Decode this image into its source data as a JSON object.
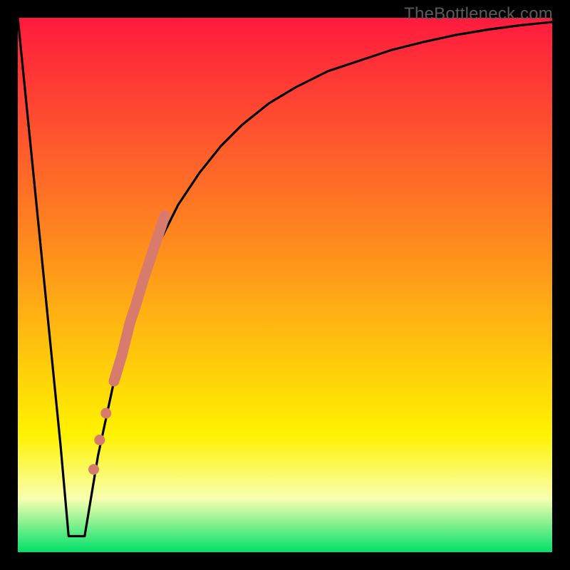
{
  "watermark": "TheBottleneck.com",
  "colors": {
    "frame": "#000000",
    "curve": "#000000",
    "markers": "#d97b6c",
    "gradient_top": "#ff1a3e",
    "gradient_mid1": "#ff8a1e",
    "gradient_mid2": "#fff200",
    "gradient_band": "#f8ffb0",
    "gradient_bottom": "#00e06a"
  },
  "chart_data": {
    "type": "line",
    "title": "",
    "xlabel": "",
    "ylabel": "",
    "xlim": [
      0,
      100
    ],
    "ylim": [
      0,
      100
    ],
    "series": [
      {
        "name": "bottleneck-curve",
        "x": [
          0,
          4,
          8,
          9.5,
          11,
          12.5,
          15,
          18,
          21,
          24,
          27,
          30,
          34,
          38,
          42,
          47,
          52,
          58,
          64,
          70,
          76,
          82,
          88,
          94,
          100
        ],
        "values": [
          100,
          60,
          20,
          3,
          3,
          3,
          18,
          32,
          43,
          52,
          59,
          65,
          71,
          76,
          80,
          84,
          87,
          90,
          92,
          94,
          95.5,
          96.8,
          97.8,
          98.6,
          99.2
        ]
      }
    ],
    "flat_bottom": {
      "x_start": 9.5,
      "x_end": 12.5,
      "y": 3
    },
    "marker_band": {
      "name": "highlighted-range",
      "x": [
        18.0,
        19.5,
        21.0,
        22.0,
        23.5,
        24.5,
        25.5,
        26.5,
        27.5
      ],
      "values": [
        32.0,
        37.0,
        43.0,
        46.0,
        51.0,
        54.0,
        57.0,
        60.0,
        63.0
      ]
    },
    "marker_points": {
      "name": "highlighted-dots",
      "x": [
        16.5,
        15.3,
        14.2
      ],
      "values": [
        26.0,
        21.0,
        15.5
      ]
    }
  }
}
